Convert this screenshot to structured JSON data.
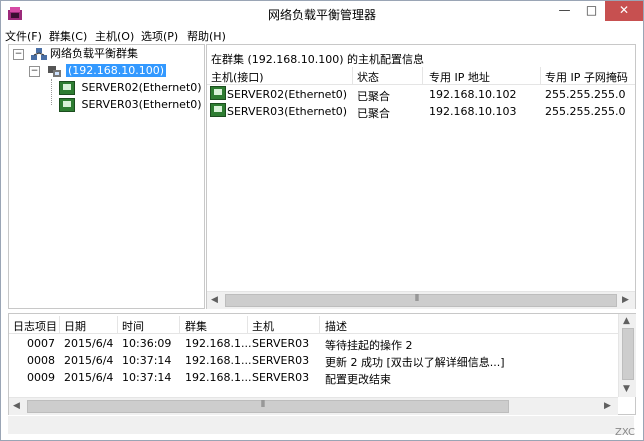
{
  "window": {
    "title": "网络负载平衡管理器",
    "min": "—",
    "max": "□",
    "close": "✕"
  },
  "menu": [
    "文件(F)",
    "群集(C)",
    "主机(O)",
    "选项(P)",
    "帮助(H)"
  ],
  "tree": {
    "root": "网络负载平衡群集",
    "cluster": "(192.168.10.100)",
    "hosts": [
      "SERVER02(Ethernet0)",
      "SERVER03(Ethernet0)"
    ]
  },
  "details": {
    "heading": "在群集 (192.168.10.100) 的主机配置信息",
    "columns": [
      "主机(接口)",
      "状态",
      "专用 IP 地址",
      "专用 IP 子网掩码"
    ],
    "rows": [
      [
        "SERVER02(Ethernet0)",
        "已聚合",
        "192.168.10.102",
        "255.255.255.0"
      ],
      [
        "SERVER03(Ethernet0)",
        "已聚合",
        "192.168.10.103",
        "255.255.255.0"
      ]
    ]
  },
  "log": {
    "columns": [
      "日志项目",
      "日期",
      "时间",
      "群集",
      "主机",
      "描述"
    ],
    "rows": [
      [
        "0007",
        "2015/6/4",
        "10:36:09",
        "192.168.1...",
        "SERVER03",
        "等待挂起的操作 2"
      ],
      [
        "0008",
        "2015/6/4",
        "10:37:14",
        "192.168.1...",
        "SERVER03",
        "更新 2 成功 [双击以了解详细信息...]"
      ],
      [
        "0009",
        "2015/6/4",
        "10:37:14",
        "192.168.1...",
        "SERVER03",
        "配置更改结束"
      ]
    ]
  },
  "watermark": "ZXC",
  "icons": {
    "app": "nlb-manager-icon",
    "root": "cluster-group-icon",
    "cluster": "cluster-icon",
    "host": "server-host-icon"
  },
  "colors": {
    "selection": "#3399ff",
    "close": "#c75050",
    "host_icon": "#2e7d32"
  }
}
